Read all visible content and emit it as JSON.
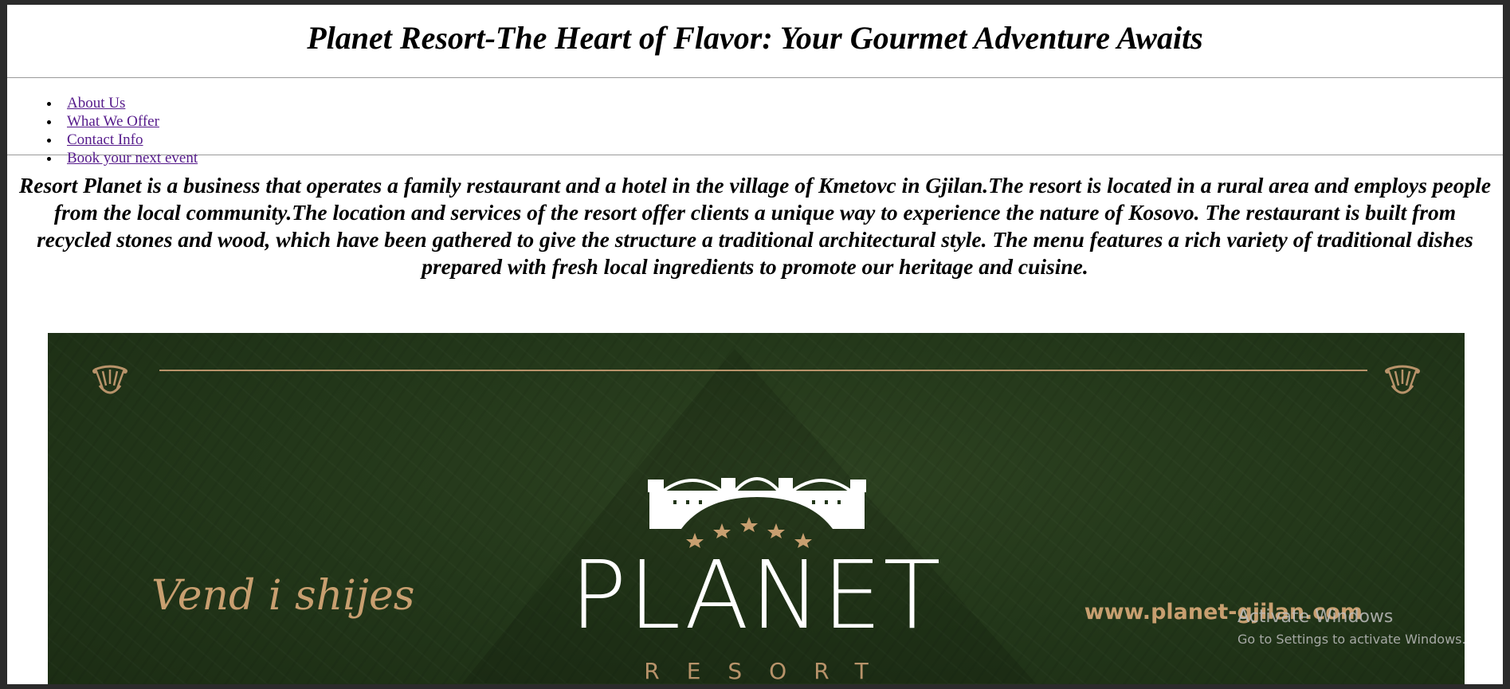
{
  "header": {
    "title": "Planet Resort-The Heart of Flavor: Your Gourmet Adventure Awaits"
  },
  "nav": {
    "items": [
      {
        "label": "About Us"
      },
      {
        "label": "What We Offer"
      },
      {
        "label": "Contact Info"
      },
      {
        "label": "Book your next event"
      }
    ]
  },
  "intro": {
    "text": "Resort Planet is a business that operates a family restaurant and a hotel in the village of Kmetovc in Gjilan.The resort is located in a rural area and employs people from the local community.The location and services of the resort offer clients a unique way to experience the nature of Kosovo. The restaurant is built from recycled stones and wood, which have been gathered to give the structure a traditional architectural style. The menu features a rich variety of traditional dishes prepared with fresh local ingredients to promote our heritage and cuisine."
  },
  "banner": {
    "brand": "PLANET",
    "brand_sub": "RESORT",
    "slogan": "Vend i shijes",
    "website": "www.planet-gjilan.com",
    "icons": [
      "ornament-icon",
      "bridge-logo-icon",
      "star-icon"
    ],
    "colors": {
      "background": "#223619",
      "gold": "#b8936a",
      "brand": "#ffffff"
    }
  },
  "watermark": {
    "line1": "Activate Windows",
    "line2": "Go to Settings to activate Windows."
  },
  "colors": {
    "link": "#551a8b",
    "frame": "#2b2b2b"
  }
}
